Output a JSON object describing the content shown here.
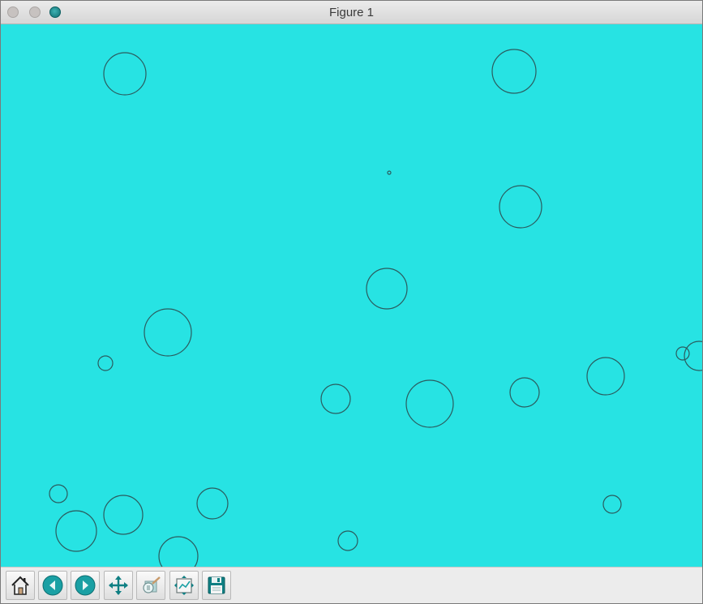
{
  "window": {
    "title": "Figure 1",
    "title_color": "#3a3a3a"
  },
  "colors": {
    "canvas_background": "#27e3e3",
    "circle_stroke": "#2b5b5e",
    "icon_teal": "#1aa0a4"
  },
  "toolbar": {
    "buttons": [
      {
        "name": "home",
        "icon": "home-icon"
      },
      {
        "name": "back",
        "icon": "arrow-left-icon"
      },
      {
        "name": "forward",
        "icon": "arrow-right-icon"
      },
      {
        "name": "pan",
        "icon": "move-arrows-icon"
      },
      {
        "name": "zoom",
        "icon": "zoom-rect-icon"
      },
      {
        "name": "configure-subplots",
        "icon": "subplots-icon"
      },
      {
        "name": "save",
        "icon": "floppy-disk-icon"
      }
    ]
  }
}
